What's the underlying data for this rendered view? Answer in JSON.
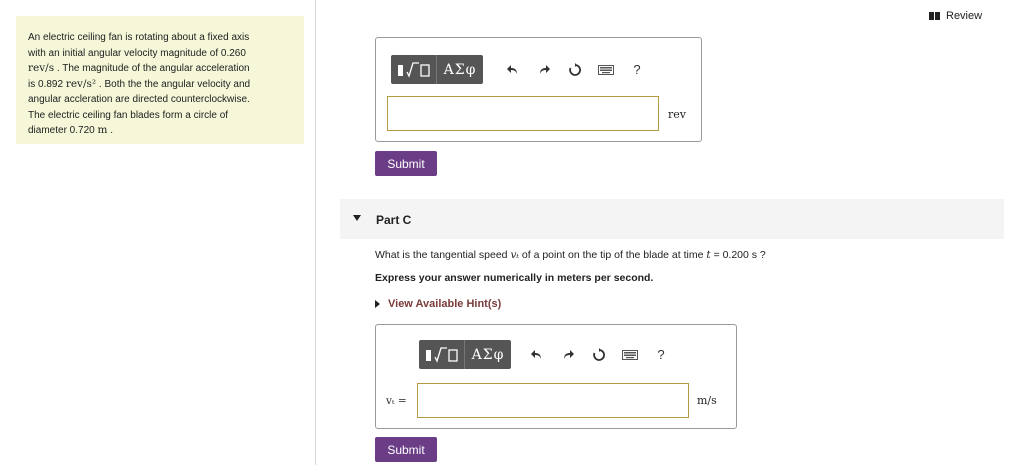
{
  "problem": {
    "line1": "An electric ceiling fan is rotating about a fixed axis",
    "line2": "with an initial angular velocity magnitude of 0.260",
    "line3_unit": "rev/s",
    "line3_text": ". The magnitude of the angular acceleration",
    "line4_prefix": "is 0.892",
    "line4_unit": "rev/s²",
    "line4_text": ". Both the the angular velocity and",
    "line5": "angular accleration are directed counterclockwise.",
    "line6": "The electric ceiling fan blades form a circle of",
    "line7_prefix": "diameter 0.720",
    "line7_unit": "m",
    "line7_suffix": "."
  },
  "header": {
    "review_label": "Review"
  },
  "partB": {
    "toolbar": {
      "greek_label": "ΑΣφ",
      "help_label": "?"
    },
    "unit": "rev",
    "submit_label": "Submit"
  },
  "partC": {
    "title": "Part C",
    "question_prefix": "What is the tangential speed",
    "question_var": "vₜ",
    "question_mid": "of a point on the tip of the blade at time",
    "question_tvar": "t",
    "question_suffix": "= 0.200 s ?",
    "instruction": "Express your answer numerically in meters per second.",
    "hint_label": "View Available Hint(s)",
    "toolbar": {
      "greek_label": "ΑΣφ",
      "help_label": "?"
    },
    "var_label": "vₜ =",
    "unit": "m/s",
    "submit_label": "Submit"
  },
  "icons": {
    "templates": "templates-icon",
    "undo": "undo-icon",
    "redo": "redo-icon",
    "reset": "reset-icon",
    "keyboard": "keyboard-icon",
    "help": "help-icon",
    "review": "book-icon"
  }
}
